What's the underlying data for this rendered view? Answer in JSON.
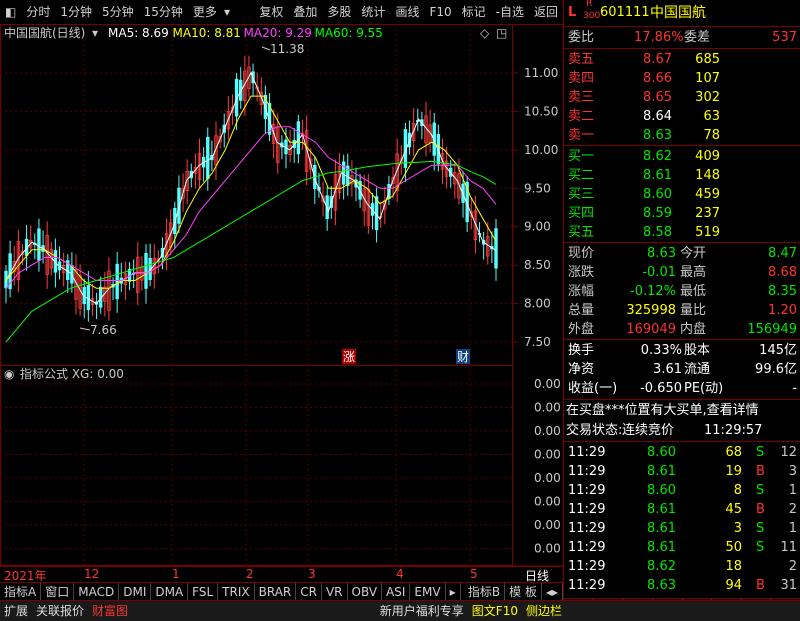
{
  "toolbar": {
    "periods": [
      "分时",
      "1分钟",
      "5分钟",
      "15分钟",
      "更多"
    ],
    "tools": [
      "复权",
      "叠加",
      "多股",
      "统计",
      "画线",
      "F10",
      "标记",
      "-自选",
      "返回"
    ]
  },
  "chart": {
    "title": "中国国航(日线)",
    "ma_labels": [
      {
        "text": "MA5: 8.69",
        "color": "#ffffff"
      },
      {
        "text": "MA10: 8.81",
        "color": "#ffff00"
      },
      {
        "text": "MA20: 9.29",
        "color": "#ff40ff"
      },
      {
        "text": "MA60: 9.55",
        "color": "#00ff00"
      }
    ],
    "price_axis": [
      "11.00",
      "10.50",
      "10.00",
      "9.50",
      "9.00",
      "8.50",
      "8.00",
      "7.50"
    ],
    "high_label": "11.38",
    "low_label": "7.66",
    "markers": [
      {
        "text": "涨",
        "color": "#d00000"
      },
      {
        "text": "财",
        "color": "#1060c0"
      }
    ],
    "indicator_title": "指标公式 XG: 0.00",
    "indicator_axis": [
      "0.00",
      "0.00",
      "0.00",
      "0.00",
      "0.00",
      "0.00",
      "0.00",
      "0.00"
    ],
    "date_axis": [
      "2021年",
      "12",
      "1",
      "2",
      "3",
      "4",
      "5"
    ],
    "period_label": "日线"
  },
  "chart_data": {
    "type": "line",
    "title": "中国国航(日线)",
    "ylim": [
      7.4,
      11.6
    ],
    "series": [
      {
        "name": "MA5",
        "values": [
          8.3,
          8.6,
          8.8,
          8.7,
          8.5,
          8.4,
          8.1,
          8.0,
          8.2,
          8.3,
          8.4,
          8.4,
          8.6,
          9.0,
          9.6,
          9.8,
          9.9,
          10.3,
          10.7,
          11.0,
          10.6,
          10.1,
          10.0,
          10.2,
          9.6,
          9.2,
          9.7,
          9.6,
          9.3,
          9.1,
          9.6,
          10.0,
          10.4,
          10.2,
          9.8,
          9.6,
          9.2,
          8.8,
          8.69
        ]
      },
      {
        "name": "MA10",
        "values": [
          8.3,
          8.5,
          8.7,
          8.7,
          8.6,
          8.5,
          8.3,
          8.2,
          8.2,
          8.3,
          8.3,
          8.4,
          8.5,
          8.8,
          9.2,
          9.5,
          9.7,
          10.0,
          10.4,
          10.7,
          10.7,
          10.4,
          10.1,
          10.1,
          9.9,
          9.5,
          9.5,
          9.6,
          9.5,
          9.3,
          9.4,
          9.7,
          10.0,
          10.1,
          10.0,
          9.8,
          9.4,
          9.1,
          8.81
        ]
      },
      {
        "name": "MA20",
        "values": [
          8.2,
          8.4,
          8.5,
          8.6,
          8.6,
          8.5,
          8.4,
          8.3,
          8.3,
          8.3,
          8.4,
          8.4,
          8.5,
          8.7,
          8.9,
          9.2,
          9.4,
          9.6,
          9.8,
          10.0,
          10.2,
          10.3,
          10.3,
          10.2,
          10.1,
          9.9,
          9.8,
          9.7,
          9.6,
          9.5,
          9.5,
          9.6,
          9.7,
          9.8,
          9.8,
          9.8,
          9.6,
          9.5,
          9.29
        ]
      },
      {
        "name": "MA60",
        "values": [
          7.5,
          7.7,
          7.9,
          8.0,
          8.1,
          8.2,
          8.25,
          8.3,
          8.35,
          8.4,
          8.45,
          8.5,
          8.55,
          8.6,
          8.7,
          8.8,
          8.9,
          9.0,
          9.1,
          9.2,
          9.3,
          9.4,
          9.5,
          9.6,
          9.65,
          9.7,
          9.72,
          9.75,
          9.78,
          9.8,
          9.82,
          9.83,
          9.84,
          9.85,
          9.83,
          9.8,
          9.72,
          9.65,
          9.55
        ]
      }
    ]
  },
  "quote": {
    "level": "L",
    "r_label": "R",
    "r_num": "300",
    "code": "601111",
    "name": "中国国航",
    "weibi_label": "委比",
    "weibi": "17.86%",
    "weicha_label": "委差",
    "weicha": "537",
    "asks": [
      {
        "label": "卖五",
        "price": "8.67",
        "vol": "685",
        "pcolor": "#ff3232"
      },
      {
        "label": "卖四",
        "price": "8.66",
        "vol": "107",
        "pcolor": "#ff3232"
      },
      {
        "label": "卖三",
        "price": "8.65",
        "vol": "302",
        "pcolor": "#ff3232"
      },
      {
        "label": "卖二",
        "price": "8.64",
        "vol": "63",
        "pcolor": "#ffffff"
      },
      {
        "label": "卖一",
        "price": "8.63",
        "vol": "78",
        "pcolor": "#00e600"
      }
    ],
    "bids": [
      {
        "label": "买一",
        "price": "8.62",
        "vol": "409"
      },
      {
        "label": "买二",
        "price": "8.61",
        "vol": "148"
      },
      {
        "label": "买三",
        "price": "8.60",
        "vol": "459"
      },
      {
        "label": "买四",
        "price": "8.59",
        "vol": "237"
      },
      {
        "label": "买五",
        "price": "8.58",
        "vol": "519"
      }
    ],
    "stats": [
      {
        "l1": "现价",
        "v1": "8.63",
        "c1": "#00e600",
        "l2": "今开",
        "v2": "8.47",
        "c2": "#00e600"
      },
      {
        "l1": "涨跌",
        "v1": "-0.01",
        "c1": "#00e600",
        "l2": "最高",
        "v2": "8.68",
        "c2": "#ff3232"
      },
      {
        "l1": "涨幅",
        "v1": "-0.12%",
        "c1": "#00e600",
        "l2": "最低",
        "v2": "8.35",
        "c2": "#00e600"
      },
      {
        "l1": "总量",
        "v1": "325998",
        "c1": "#ffff00",
        "l2": "量比",
        "v2": "1.20",
        "c2": "#ff3232"
      },
      {
        "l1": "外盘",
        "v1": "169049",
        "c1": "#ff3232",
        "l2": "内盘",
        "v2": "156949",
        "c2": "#00e600"
      }
    ],
    "fund": [
      {
        "l1": "换手",
        "v1": "0.33%",
        "l2": "股本",
        "v2": "145亿"
      },
      {
        "l1": "净资",
        "v1": "3.61",
        "l2": "流通",
        "v2": "99.6亿"
      },
      {
        "l1": "收益(一)",
        "v1": "-0.650",
        "l2": "PE(动)",
        "v2": "-"
      }
    ],
    "notice": "在买盘***位置有大买单,查看详情",
    "trade_status_label": "交易状态:",
    "trade_status": "连续竞价",
    "trade_time": "11:29:57",
    "ticks": [
      {
        "t": "11:29",
        "p": "8.60",
        "v": "68",
        "s": "S",
        "n": "12"
      },
      {
        "t": "11:29",
        "p": "8.61",
        "v": "19",
        "s": "B",
        "n": "3"
      },
      {
        "t": "11:29",
        "p": "8.60",
        "v": "8",
        "s": "S",
        "n": "1"
      },
      {
        "t": "11:29",
        "p": "8.61",
        "v": "45",
        "s": "B",
        "n": "2"
      },
      {
        "t": "11:29",
        "p": "8.61",
        "v": "3",
        "s": "S",
        "n": "1"
      },
      {
        "t": "11:29",
        "p": "8.61",
        "v": "50",
        "s": "S",
        "n": "11"
      },
      {
        "t": "11:29",
        "p": "8.62",
        "v": "18",
        "s": "",
        "n": "2"
      },
      {
        "t": "11:29",
        "p": "8.63",
        "v": "94",
        "s": "B",
        "n": "31"
      }
    ],
    "panel_tabs": [
      "笔",
      "价",
      "细",
      "势",
      "联",
      "值",
      "主",
      "筹"
    ]
  },
  "indicator_tabs": [
    "指标A",
    "窗口",
    "MACD",
    "DMI",
    "DMA",
    "FSL",
    "TRIX",
    "BRAR",
    "CR",
    "VR",
    "OBV",
    "ASI",
    "EMV"
  ],
  "indicator_tabs_right": [
    "指标B",
    "模 板"
  ],
  "status_bar": {
    "left": [
      "扩展",
      "关联报价",
      "财富图"
    ],
    "right": [
      "新用户福利专享",
      "图文F10",
      "侧边栏"
    ]
  }
}
